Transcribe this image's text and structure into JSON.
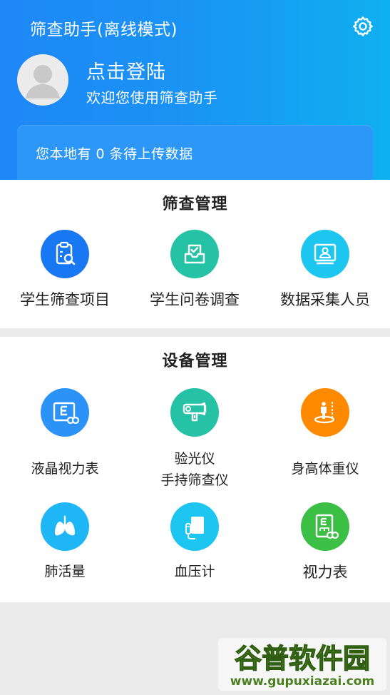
{
  "header": {
    "title": "筛查助手(离线模式)",
    "login": "点击登陆",
    "welcome": "欢迎您使用筛查助手",
    "upload_notice": "您本地有 0 条待上传数据",
    "settings_icon": "gear-icon",
    "colors": {
      "gradient_start": "#1e88f6",
      "gradient_end": "#0fb0f0"
    }
  },
  "screening": {
    "title": "筛查管理",
    "items": [
      {
        "label": "学生筛查项目",
        "icon": "clipboard-search-icon",
        "color": "#1877f2"
      },
      {
        "label": "学生问卷调查",
        "icon": "questionnaire-tray-icon",
        "color": "#26c2a5"
      },
      {
        "label": "数据采集人员",
        "icon": "monitor-person-icon",
        "color": "#1dc6f0"
      }
    ]
  },
  "devices": {
    "title": "设备管理",
    "items": [
      {
        "label": "液晶视力表",
        "icon": "eye-chart-screen-icon",
        "color": "#2b93f7"
      },
      {
        "label_line1": "验光仪",
        "label_line2": "手持筛查仪",
        "icon": "handheld-refractor-icon",
        "color": "#26c2a5"
      },
      {
        "label": "身高体重仪",
        "icon": "height-scale-icon",
        "color": "#ff8a00"
      },
      {
        "label": "肺活量",
        "icon": "lungs-icon",
        "color": "#1fb6f5"
      },
      {
        "label": "血压计",
        "icon": "blood-pressure-monitor-icon",
        "color": "#1dc6f0"
      },
      {
        "label": "视力表",
        "icon": "eye-chart-icon",
        "color": "#3bbf45"
      }
    ]
  },
  "watermark": {
    "name": "谷普软件园",
    "url": "www.gupuxiazai.com"
  }
}
